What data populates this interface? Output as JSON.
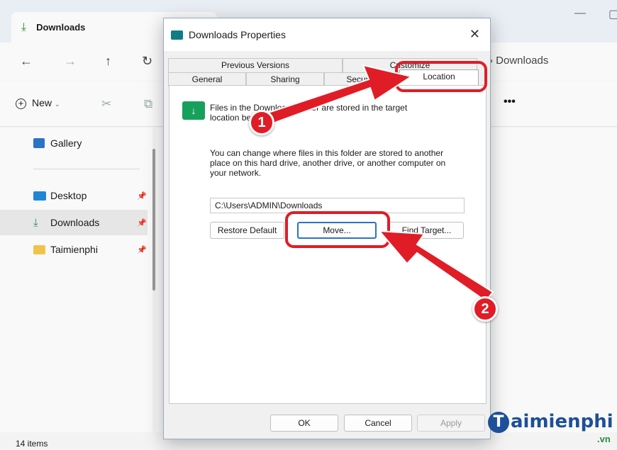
{
  "explorer": {
    "tab_title": "Downloads",
    "address": "› Downloads",
    "toolbar": {
      "new_label": "New",
      "more": "•••"
    },
    "sidebar": [
      {
        "label": "Gallery"
      },
      {
        "label": "Desktop"
      },
      {
        "label": "Downloads"
      },
      {
        "label": "Taimienphi"
      }
    ],
    "status": "14 items"
  },
  "dialog": {
    "title": "Downloads Properties",
    "tabs_top": [
      "Previous Versions",
      "Customize"
    ],
    "tabs_bottom": [
      "General",
      "Sharing",
      "Security",
      "Location"
    ],
    "active_tab": "Location",
    "info_line1": "Files in the Downloads folder are stored in the target",
    "info_line2": "location below.",
    "desc_line1": "You can change where files in this folder are stored to another",
    "desc_line2": "place on this hard drive, another drive, or another computer on",
    "desc_line3": "your network.",
    "path": "C:\\Users\\ADMIN\\Downloads",
    "buttons": {
      "restore": "Restore Default",
      "move": "Move...",
      "find": "Find Target...",
      "ok": "OK",
      "cancel": "Cancel",
      "apply": "Apply"
    }
  },
  "annotations": {
    "badge1": "1",
    "badge2": "2",
    "color": "#e01d27"
  },
  "watermark": {
    "brand": "aimienphi",
    "t": "T",
    "tld": ".vn"
  }
}
